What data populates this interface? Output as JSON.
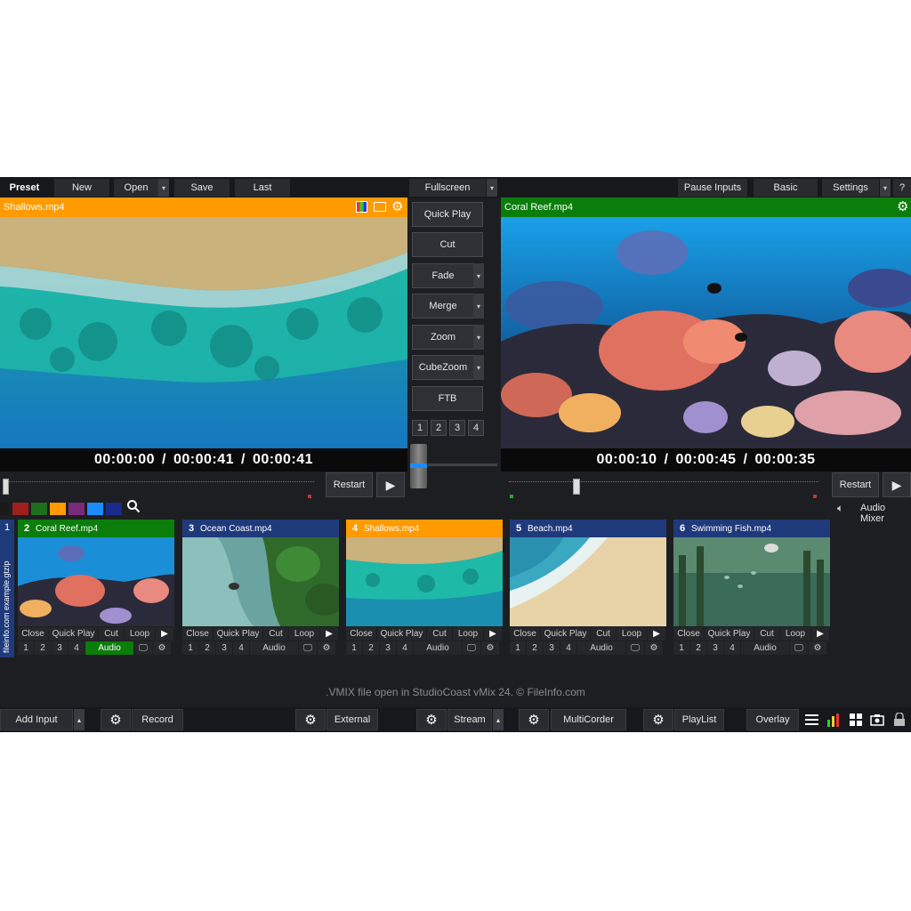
{
  "topbar": {
    "preset": "Preset",
    "new": "New",
    "open": "Open",
    "save": "Save",
    "last": "Last",
    "fullscreen": "Fullscreen",
    "pause_inputs": "Pause Inputs",
    "basic": "Basic",
    "settings": "Settings",
    "help": "?"
  },
  "preview": {
    "title": "Shallows.mp4",
    "time_pos": "00:00:00",
    "time_dur": "00:00:41",
    "time_rem": "00:00:41",
    "sep": "/",
    "restart": "Restart",
    "accent": "#ff9a00"
  },
  "output": {
    "title": "Coral Reef.mp4",
    "time_pos": "00:00:10",
    "time_dur": "00:00:45",
    "time_rem": "00:00:35",
    "sep": "/",
    "restart": "Restart",
    "accent": "#0b7d0b"
  },
  "transitions": {
    "quick_play": "Quick Play",
    "cut": "Cut",
    "fade": "Fade",
    "merge": "Merge",
    "zoom": "Zoom",
    "cubezoom": "CubeZoom",
    "ftb": "FTB",
    "numbers": [
      "1",
      "2",
      "3",
      "4"
    ]
  },
  "colors": [
    "#1a1a1a",
    "#a01e1e",
    "#1e6e1e",
    "#ff9a00",
    "#7a2a7a",
    "#1a8cff",
    "#1a2a8a"
  ],
  "audio_mixer": "Audio Mixer",
  "side_tab": {
    "number": "1",
    "label": "fileinfo.com example.gtzip"
  },
  "inputs": [
    {
      "num": "2",
      "name": "Coral Reef.mp4",
      "header_color": "#0b7d0b",
      "audio_active": true
    },
    {
      "num": "3",
      "name": "Ocean Coast.mp4",
      "header_color": "#1f3a7a",
      "audio_active": false
    },
    {
      "num": "4",
      "name": "Shallows.mp4",
      "header_color": "#ff9a00",
      "audio_active": false
    },
    {
      "num": "5",
      "name": "Beach.mp4",
      "header_color": "#1f3a7a",
      "audio_active": false
    },
    {
      "num": "6",
      "name": "Swimming Fish.mp4",
      "header_color": "#1f3a7a",
      "audio_active": false
    }
  ],
  "input_controls": {
    "close": "Close",
    "quick_play": "Quick Play",
    "cut": "Cut",
    "loop": "Loop",
    "audio": "Audio",
    "n1": "1",
    "n2": "2",
    "n3": "3",
    "n4": "4"
  },
  "watermark": ".VMIX file open in StudioCoast vMix 24. © FileInfo.com",
  "bottombar": {
    "add_input": "Add Input",
    "record": "Record",
    "external": "External",
    "stream": "Stream",
    "multicorder": "MultiCorder",
    "playlist": "PlayList",
    "overlay": "Overlay"
  }
}
